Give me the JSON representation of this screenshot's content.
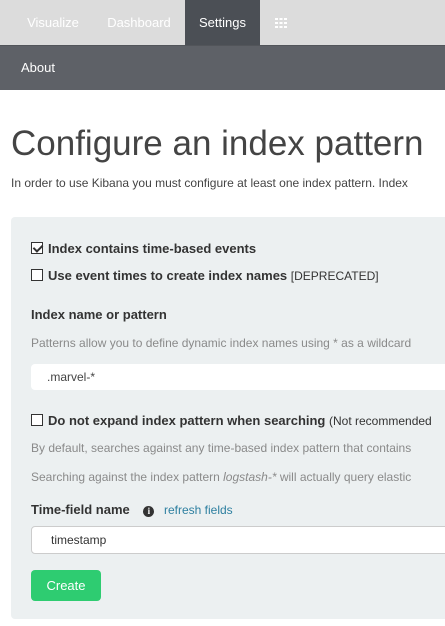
{
  "nav": {
    "tabs": [
      {
        "label": "Visualize"
      },
      {
        "label": "Dashboard"
      },
      {
        "label": "Settings"
      }
    ],
    "apps_icon": "grid-icon",
    "active_tab": "Settings"
  },
  "subnav": {
    "items": [
      {
        "label": "About"
      }
    ]
  },
  "page": {
    "title": "Configure an index pattern",
    "intro": "In order to use Kibana you must configure at least one index pattern. Index"
  },
  "form": {
    "time_based": {
      "label": "Index contains time-based events",
      "checked": true
    },
    "event_times": {
      "label": "Use event times to create index names",
      "suffix": "[DEPRECATED]",
      "checked": false
    },
    "index_name": {
      "label": "Index name or pattern",
      "help": "Patterns allow you to define dynamic index names using * as a wildcard",
      "value": ".marvel-*"
    },
    "no_expand": {
      "label": "Do not expand index pattern when searching",
      "suffix": "(Not recommended",
      "checked": false,
      "help1": "By default, searches against any time-based index pattern that contains",
      "help2_prefix": "Searching against the index pattern ",
      "help2_em": "logstash-*",
      "help2_suffix": " will actually query elastic"
    },
    "time_field": {
      "label": "Time-field name",
      "info_icon": "info-icon",
      "refresh_label": "refresh fields",
      "value": "timestamp"
    },
    "create_label": "Create"
  },
  "colors": {
    "topnav_bg": "#dcdcdc",
    "active_tab_bg": "#4b4f55",
    "subnav_bg": "#5e6167",
    "panel_bg": "#ecf0f1",
    "create_button": "#2ecc71",
    "link": "#2d7fa0"
  }
}
